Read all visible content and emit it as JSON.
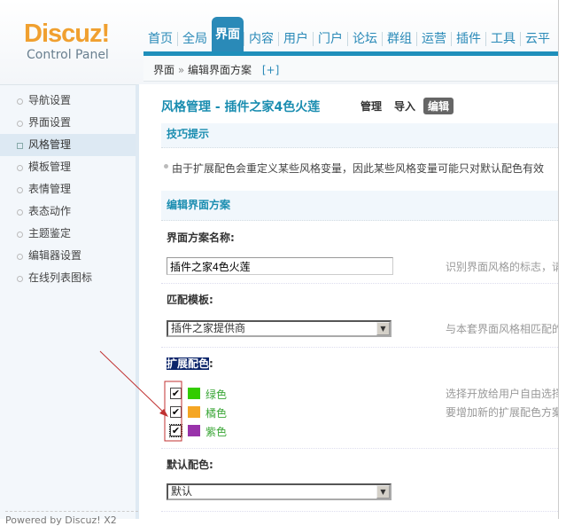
{
  "logo": {
    "brand": "Discuz!",
    "subtitle": "Control Panel"
  },
  "nav": [
    "首页",
    "全局",
    "界面",
    "内容",
    "用户",
    "门户",
    "论坛",
    "群组",
    "运营",
    "插件",
    "工具",
    "云平"
  ],
  "breadcrumb": {
    "section": "界面",
    "sep": "»",
    "page": "编辑界面方案",
    "add": "[+]"
  },
  "sidebar": {
    "items": [
      "导航设置",
      "界面设置",
      "风格管理",
      "模板管理",
      "表情管理",
      "表态动作",
      "主题鉴定",
      "编辑器设置",
      "在线列表图标"
    ],
    "footer": "Powered by Discuz! X2"
  },
  "main": {
    "title": "风格管理  - 插件之家4色火莲",
    "tabs": [
      "管理",
      "导入",
      "编辑"
    ],
    "tips_header": "技巧提示",
    "tip": "由于扩展配色会重定义某些风格变量，因此某些风格变量可能只对默认配色有效",
    "form_header": "编辑界面方案",
    "name_label": "界面方案名称:",
    "name_value": "插件之家4色火莲",
    "name_help": "识别界面风格的标志，请",
    "template_label": "匹配模板:",
    "template_value": "插件之家提供商",
    "template_help": "与本套界面风格相匹配的",
    "ext_label": "扩展配色",
    "ext_colon": ":",
    "colors": [
      {
        "name": "绿色",
        "color": "#33cc00",
        "checked": true
      },
      {
        "name": "橘色",
        "color": "#f5a623",
        "checked": true
      },
      {
        "name": "紫色",
        "color": "#9933aa",
        "checked": true
      }
    ],
    "ext_help1": "选择开放给用户自由选择",
    "ext_help2": "要增加新的扩展配色方案",
    "default_label": "默认配色:",
    "default_value": "默认",
    "check_mark": "✔"
  }
}
